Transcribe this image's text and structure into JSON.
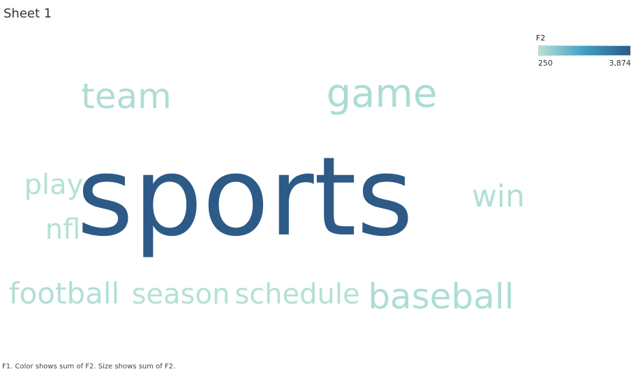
{
  "sheet": {
    "title": "Sheet 1"
  },
  "legend": {
    "title": "F2",
    "min_label": "250",
    "max_label": "3,874",
    "color_low": "#b5e1d6",
    "color_mid": "#3f9fc1",
    "color_high": "#2d5a87"
  },
  "footnote": "F1.  Color shows sum of F2.  Size shows sum of F2.",
  "chart_data": {
    "type": "word-cloud",
    "measure": "F2",
    "color_range": [
      250,
      3874
    ],
    "words": [
      {
        "text": "sports",
        "value": 3874
      },
      {
        "text": "game",
        "value": 400
      },
      {
        "text": "team",
        "value": 350
      },
      {
        "text": "baseball",
        "value": 350
      },
      {
        "text": "win",
        "value": 300
      },
      {
        "text": "football",
        "value": 300
      },
      {
        "text": "schedule",
        "value": 270
      },
      {
        "text": "season",
        "value": 260
      },
      {
        "text": "play",
        "value": 260
      },
      {
        "text": "nfl",
        "value": 250
      }
    ]
  }
}
